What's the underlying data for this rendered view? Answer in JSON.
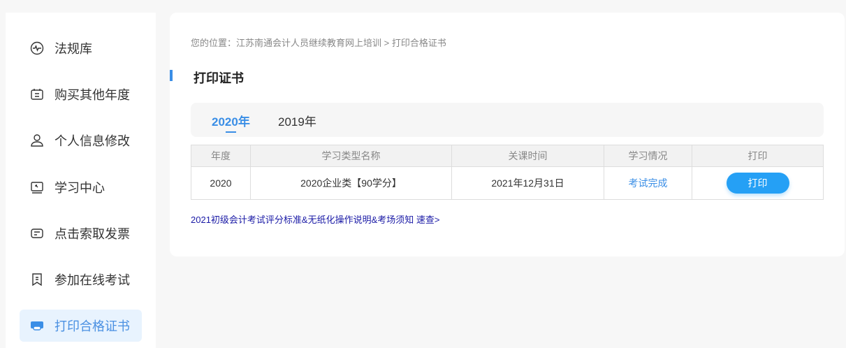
{
  "sidebar": {
    "items": [
      {
        "label": "法规库",
        "icon": "pulse-icon"
      },
      {
        "label": "购买其他年度",
        "icon": "calendar-icon"
      },
      {
        "label": "个人信息修改",
        "icon": "user-icon"
      },
      {
        "label": "学习中心",
        "icon": "screen-icon"
      },
      {
        "label": "点击索取发票",
        "icon": "invoice-icon"
      },
      {
        "label": "参加在线考试",
        "icon": "exam-icon"
      },
      {
        "label": "打印合格证书",
        "icon": "printer-icon",
        "active": true
      }
    ]
  },
  "breadcrumb": "您的位置：江苏南通会计人员继续教育网上培训 > 打印合格证书",
  "title": "打印证书",
  "tabs": [
    "2020年",
    "2019年"
  ],
  "table": {
    "headers": [
      "年度",
      "学习类型名称",
      "关课时间",
      "学习情况",
      "打印"
    ],
    "rows": [
      {
        "year": "2020",
        "type": "2020企业类【90学分】",
        "close": "2021年12月31日",
        "status": "考试完成",
        "action": "打印"
      }
    ]
  },
  "notice": "2021初级会计考试评分标准&无纸化操作说明&考场须知 速查>",
  "colors": {
    "accent": "#3a8ee6",
    "button": "#25a0f5"
  }
}
